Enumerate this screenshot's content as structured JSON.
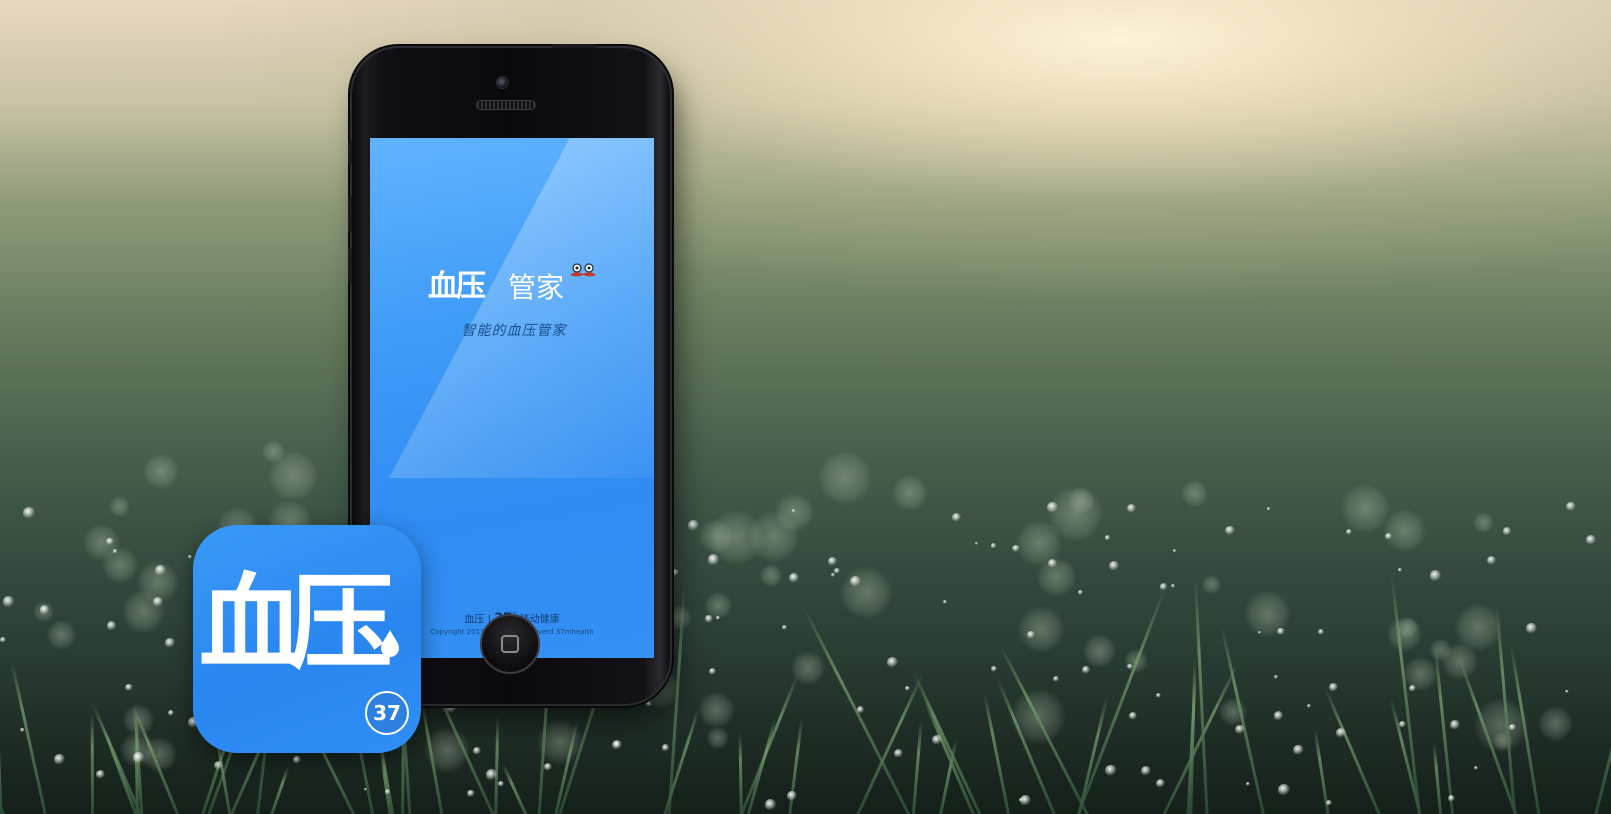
{
  "screen": {
    "logo_title": "血压",
    "logo_suffix": "管家",
    "tagline": "智能的血压管家",
    "footer_brand": "血压",
    "footer_separator": "|",
    "footer_number": "37",
    "footer_degree": "°",
    "footer_slogan": "移动健康",
    "copyright": "Copyright 2013 All Right Reserverd 37mhealth"
  },
  "app_icon": {
    "title": "血压",
    "badge": "37"
  },
  "colors": {
    "screen_blue": "#3490f3",
    "icon_blue": "#2a86f0",
    "mustache": "#c0392b"
  },
  "icons": [
    "mustache-icon",
    "blood-drop-icon",
    "home-button-icon"
  ]
}
